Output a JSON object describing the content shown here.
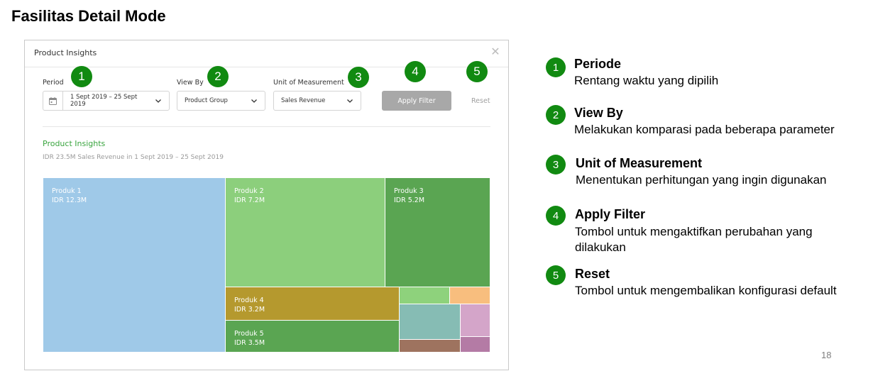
{
  "slide": {
    "title": "Fasilitas Detail Mode",
    "page_number": "18"
  },
  "modal": {
    "title": "Product Insights",
    "period": {
      "label": "Period",
      "value": "1 Sept 2019 – 25 Sept 2019"
    },
    "view_by": {
      "label": "View By",
      "value": "Product Group"
    },
    "unit": {
      "label": "Unit of Measurement",
      "value": "Sales Revenue"
    },
    "apply_label": "Apply Filter",
    "reset_label": "Reset",
    "section_title": "Product Insights",
    "section_subtitle": "IDR 23.5M Sales Revenue in 1 Sept 2019 – 25 Sept 2019"
  },
  "chart_data": {
    "type": "treemap",
    "series": [
      {
        "name": "Produk 1",
        "value": "IDR 12.3M",
        "color": "#9fc9e8"
      },
      {
        "name": "Produk 2",
        "value": "IDR 7.2M",
        "color": "#8ccf7c"
      },
      {
        "name": "Produk 3",
        "value": "IDR 5.2M",
        "color": "#5aa552"
      },
      {
        "name": "Produk 4",
        "value": "IDR 3.2M",
        "color": "#b5992e"
      },
      {
        "name": "Produk 5",
        "value": "IDR 3.5M",
        "color": "#5aa552"
      }
    ],
    "unlabeled_tile_colors": [
      "#8ed27c",
      "#f8be7e",
      "#86bcb4",
      "#d4a5c9",
      "#9e735f",
      "#b47ba5"
    ]
  },
  "badges": [
    "1",
    "2",
    "3",
    "4",
    "5"
  ],
  "legend": [
    {
      "num": "1",
      "title": "Periode",
      "desc": "Rentang waktu yang dipilih"
    },
    {
      "num": "2",
      "title": "View By",
      "desc": "Melakukan komparasi pada beberapa parameter"
    },
    {
      "num": "3",
      "title": "Unit of Measurement",
      "desc": "Menentukan perhitungan yang ingin digunakan"
    },
    {
      "num": "4",
      "title": "Apply Filter",
      "desc": "Tombol untuk mengaktifkan perubahan yang dilakukan"
    },
    {
      "num": "5",
      "title": "Reset",
      "desc": "Tombol untuk mengembalikan konfigurasi default"
    }
  ]
}
